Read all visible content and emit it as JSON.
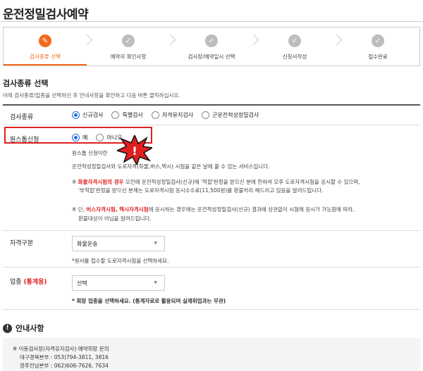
{
  "page": {
    "title": "운전정밀검사예약"
  },
  "steps": [
    {
      "label": "검사종류 선택",
      "active": true,
      "icon": "pencil-icon"
    },
    {
      "label": "예약자 확인사항",
      "active": false,
      "icon": "check-icon"
    },
    {
      "label": "검사장/예약일시 선택",
      "active": false,
      "icon": "check-icon"
    },
    {
      "label": "신청서작성",
      "active": false,
      "icon": "check-icon"
    },
    {
      "label": "접수완료",
      "active": false,
      "icon": "check-icon"
    }
  ],
  "section": {
    "title": "검사종류 선택",
    "desc": "아래 검사종류/업종을 선택하신 후 안내사항을 확인하고 다음 버튼 클릭하십시오."
  },
  "exam_type": {
    "label": "검사종류",
    "options": [
      "신규검사",
      "특별검사",
      "자격유지검사",
      "군운전적성정밀검사"
    ],
    "selected": "신규검사"
  },
  "onestop": {
    "label": "원스톱신청",
    "options": [
      "예",
      "아니오"
    ],
    "selected": "예",
    "info_title": "원스톱 신청이란",
    "info_desc": "운전적성정밀검사와 도로자격(화물,버스,택시) 시험을 같은 날에 볼 수 있는 서비스입니다.",
    "note1_prefix": "※ ",
    "note1_red": "화물자격시험의 경우",
    "note1_rest": " 오전에 운전적성정밀검사(신규)에 '적합'판정을 받으신 분에 한하여 오후 도로자격시험을 응시할 수 있으며,",
    "note1_line2": "'부적합'판정을 받으신 분께는 도로자격시험 응시수수료(11,500원)를 환불처리 해드리고 있음을 알려드립니다.",
    "note2_prefix": "※ 단, ",
    "note2_red": "버스자격시험, 택시자격시험",
    "note2_rest": "에 응시하는 경우에는 운전적성정밀검사(신규) 결과에 상관없이 시험에 응시가 가능함에 따라,",
    "note2_line2": "환불대상이 아님을 알려드립니다."
  },
  "qualification": {
    "label": "자격구분",
    "selected": "화물운송",
    "help": "*원서를 접수할 도로자격시험을 선택하세요."
  },
  "industry": {
    "label": "업종",
    "label_red": "(통계용)",
    "selected": "선택",
    "help": "* 희망 업종을 선택하세요. (통계자료로 활용되며 실제취업과는 무관)"
  },
  "guide": {
    "title": "안내사항",
    "icon": "alert-icon",
    "lines": [
      "※ 이동검사장(자격유지검사) 예약희망 문의",
      "대구경북본부 : 053)794-3811, 3816",
      "광주전남본부 : 062)606-7626, 7634"
    ]
  },
  "colors": {
    "accent": "#f26a1b",
    "radio": "#1f6fe5",
    "highlight": "#e02020"
  },
  "badge": {
    "icon": "exclamation-burst-icon"
  }
}
